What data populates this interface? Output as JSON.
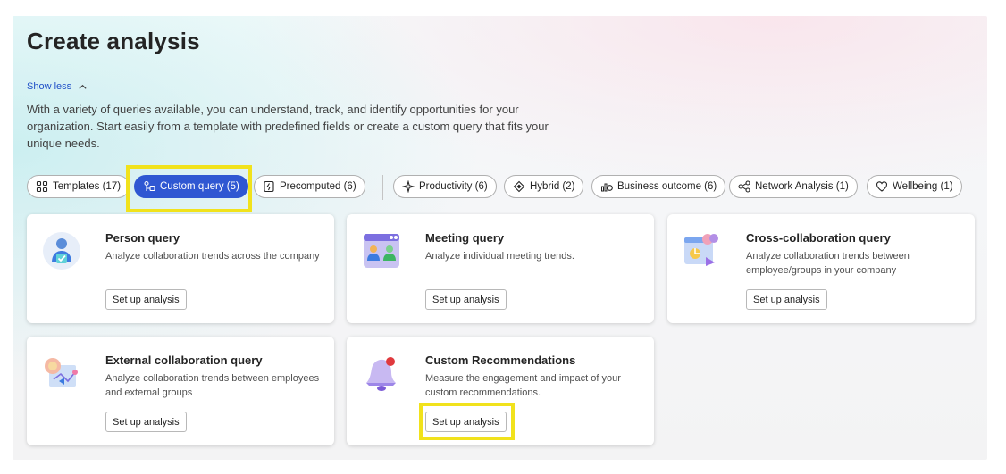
{
  "header": {
    "title": "Create analysis",
    "show_less": "Show less",
    "description": "With a variety of queries available, you can understand, track, and identify opportunities for your organization. Start easily from a template with predefined fields or create a custom query that fits your unique needs."
  },
  "filters": [
    {
      "label": "Templates (17)",
      "icon": "grid-icon"
    },
    {
      "label": "Custom query (5)",
      "icon": "custom-query-icon",
      "selected": true
    },
    {
      "label": "Precomputed (6)",
      "icon": "precomputed-icon"
    },
    {
      "label": "Productivity (6)",
      "icon": "sparkle-icon"
    },
    {
      "label": "Hybrid (2)",
      "icon": "hybrid-icon"
    },
    {
      "label": "Business outcome (6)",
      "icon": "business-outcome-icon"
    },
    {
      "label": "Network Analysis (1)",
      "icon": "network-icon"
    },
    {
      "label": "Wellbeing (1)",
      "icon": "heart-icon"
    }
  ],
  "cards": [
    {
      "title": "Person query",
      "description": "Analyze collaboration trends across the company",
      "button": "Set up analysis",
      "icon": "person-query-illustration"
    },
    {
      "title": "Meeting query",
      "description": "Analyze individual meeting trends.",
      "button": "Set up analysis",
      "icon": "meeting-query-illustration"
    },
    {
      "title": "Cross-collaboration query",
      "description": "Analyze collaboration trends between employee/groups in your company",
      "button": "Set up analysis",
      "icon": "cross-collaboration-illustration"
    },
    {
      "title": "External collaboration query",
      "description": "Analyze collaboration trends between employees and external groups",
      "button": "Set up analysis",
      "icon": "external-collaboration-illustration"
    },
    {
      "title": "Custom Recommendations",
      "description": "Measure the engagement and impact of your custom recommendations.",
      "button": "Set up analysis",
      "icon": "bell-illustration"
    }
  ],
  "colors": {
    "accent": "#2f57d2",
    "highlight": "#f1e21c",
    "link": "#2050c8"
  }
}
